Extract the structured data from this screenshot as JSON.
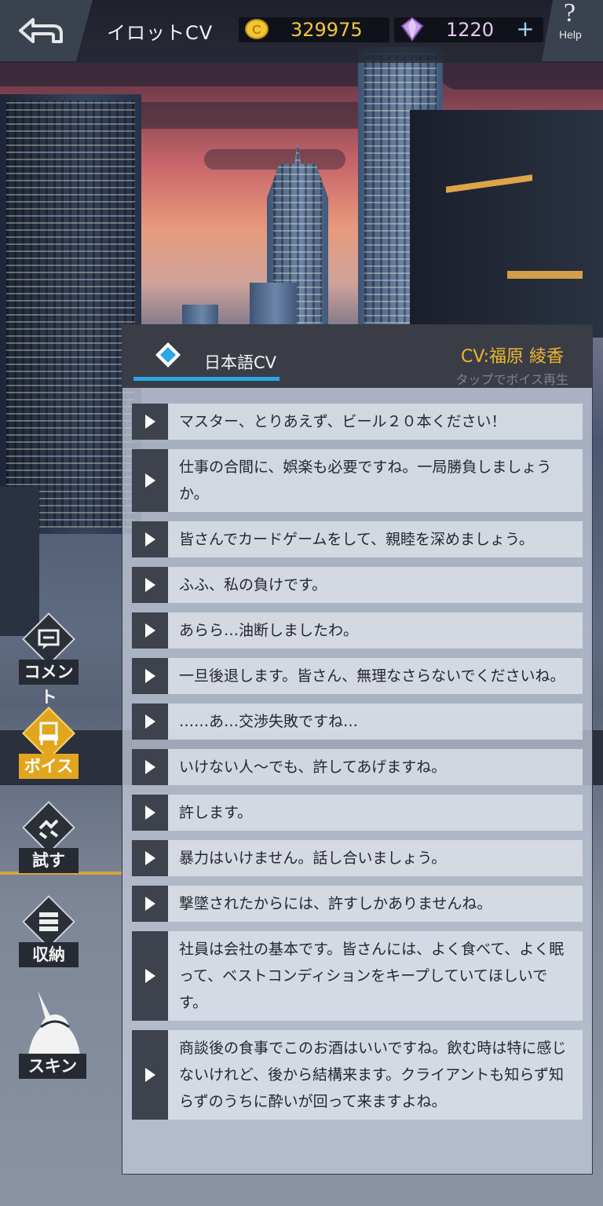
{
  "header": {
    "title": "イロットCV",
    "coins": "329975",
    "gems": "1220",
    "plus_label": "+",
    "help_label": "Help",
    "help_symbol": "?"
  },
  "side_menu": [
    {
      "label": "コメント",
      "icon": "comment-icon",
      "active": false
    },
    {
      "label": "ボイス",
      "icon": "voice-icon",
      "active": true
    },
    {
      "label": "試す",
      "icon": "try-icon",
      "active": false
    },
    {
      "label": "収納",
      "icon": "storage-icon",
      "active": false
    },
    {
      "label": "スキン",
      "icon": "skin-icon",
      "active": false
    }
  ],
  "panel": {
    "tab_label": "日本語CV",
    "cv_name": "CV:福原 綾香",
    "hint": "タップでボイス再生"
  },
  "voice_lines": [
    "マスター、とりあえず、ビール２０本ください！",
    "仕事の合間に、娯楽も必要ですね。一局勝負しましょうか。",
    "皆さんでカードゲームをして、親睦を深めましょう。",
    "ふふ、私の負けです。",
    "あらら…油断しましたわ。",
    "一旦後退します。皆さん、無理なさらないでくださいね。",
    "……あ…交渉失敗ですね…",
    "いけない人～でも、許してあげますね。",
    "許します。",
    "暴力はいけません。話し合いましょう。",
    "撃墜されたからには、許すしかありませんね。",
    "社員は会社の基本です。皆さんには、よく食べて、よく眠って、ベストコンディションをキープしていてほしいです。",
    "商談後の食事でこのお酒はいいですね。飲む時は特に感じないけれど、後から結構来ます。クライアントも知らず知らずのうちに酔いが回って来ますよね。"
  ],
  "colors": {
    "accent_gold": "#e2a61e",
    "tab_underline": "#2aa7e6",
    "coin_text": "#f2c63b",
    "gem_text": "#e6c8f4"
  }
}
